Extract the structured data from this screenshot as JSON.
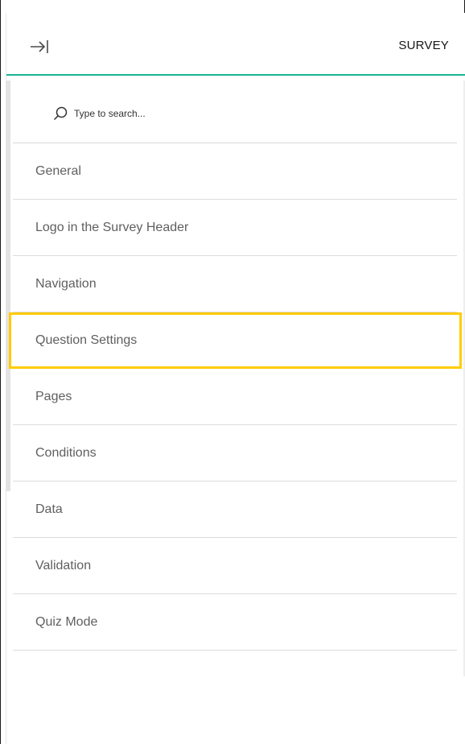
{
  "header": {
    "title": "SURVEY",
    "collapse_icon": "arrow-right-to-bar-icon"
  },
  "search": {
    "placeholder": "Type to search...",
    "value": "",
    "icon": "search-icon"
  },
  "menu": {
    "items": [
      {
        "label": "General",
        "highlighted": false
      },
      {
        "label": "Logo in the Survey Header",
        "highlighted": false
      },
      {
        "label": "Navigation",
        "highlighted": false
      },
      {
        "label": "Question Settings",
        "highlighted": true
      },
      {
        "label": "Pages",
        "highlighted": false
      },
      {
        "label": "Conditions",
        "highlighted": false
      },
      {
        "label": "Data",
        "highlighted": false
      },
      {
        "label": "Validation",
        "highlighted": false
      },
      {
        "label": "Quiz Mode",
        "highlighted": false
      }
    ]
  },
  "colors": {
    "accent": "#19b394",
    "highlight": "#ffcc00",
    "item_text": "#5f5f5f",
    "divider": "#dcdcdc"
  }
}
